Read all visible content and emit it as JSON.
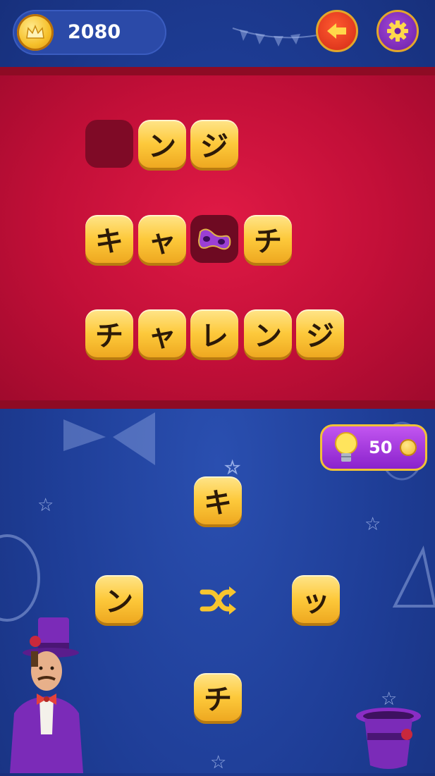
{
  "header": {
    "coins": "2080",
    "coin_icon": "coin-crown-icon",
    "back_icon": "arrow-left-icon",
    "settings_icon": "gear-icon"
  },
  "puzzle": {
    "rows": [
      {
        "letters": [
          "",
          "ン",
          "ジ"
        ]
      },
      {
        "letters": [
          "キ",
          "ャ",
          "",
          "チ"
        ]
      },
      {
        "letters": [
          "チ",
          "ャ",
          "レ",
          "ン",
          "ジ"
        ]
      }
    ],
    "special_icon": "mask-icon"
  },
  "hint": {
    "cost": "50",
    "icon": "lightbulb-icon"
  },
  "wheel": {
    "top": "キ",
    "left": "ン",
    "right": "ッ",
    "bottom": "チ",
    "shuffle_icon": "shuffle-icon"
  },
  "colors": {
    "board": "#c20f38",
    "tile": "#fdc93b",
    "background": "#1e3d96",
    "accent_purple": "#8a22cc"
  }
}
